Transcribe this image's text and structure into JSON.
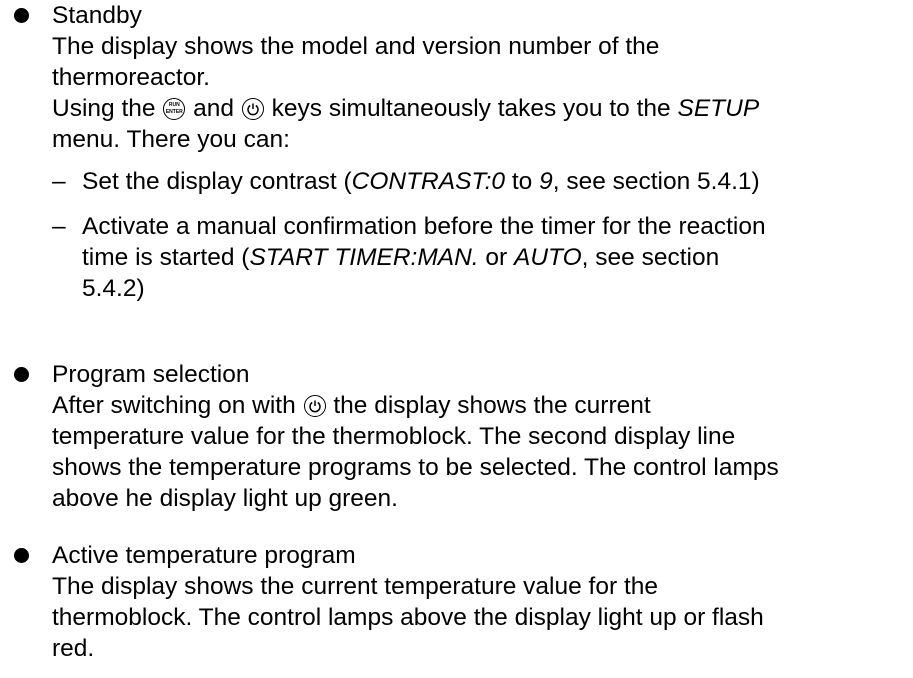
{
  "sections": [
    {
      "title": "Standby",
      "text_line1": "The display shows the model and version number of the",
      "text_line2": "thermoreactor.",
      "keys_line_prefix": "Using the",
      "keys_line_and": "and",
      "keys_line_suffix": "keys simultaneously takes you to the",
      "setup_word": "SETUP",
      "menu_line": "menu. There you can:",
      "item1": {
        "dash": "–",
        "prefix": "Set the display contrast (",
        "contrast": "CONTRAST:0",
        "to": " to ",
        "nine": "9",
        "suffix": ", see section 5.4.1)"
      },
      "item2": {
        "dash": "–",
        "line1": "Activate a manual confirmation before the timer for the reaction",
        "line2_prefix": "time is started (",
        "start_timer": "START TIMER:MAN.",
        "or": " or ",
        "auto": "AUTO",
        "line2_suffix": ", see section",
        "line3": "5.4.2)"
      }
    },
    {
      "title": "Program selection",
      "line1_prefix": "After switching on with",
      "line1_suffix": "the display shows the current",
      "line2": "temperature value for the thermoblock. The second display line",
      "line3": "shows the temperature programs to be selected. The control lamps",
      "line4": "above he display light up green."
    },
    {
      "title": "Active temperature program",
      "line1": "The display shows the current temperature value for the",
      "line2": "thermoblock. The control lamps above the display light up or flash",
      "line3": "red."
    }
  ],
  "icons": {
    "run_key": {
      "name": "run-enter-key-icon",
      "label_top": "RUN",
      "label_bottom": "ENTER"
    },
    "power_key": {
      "name": "power-key-icon"
    }
  }
}
